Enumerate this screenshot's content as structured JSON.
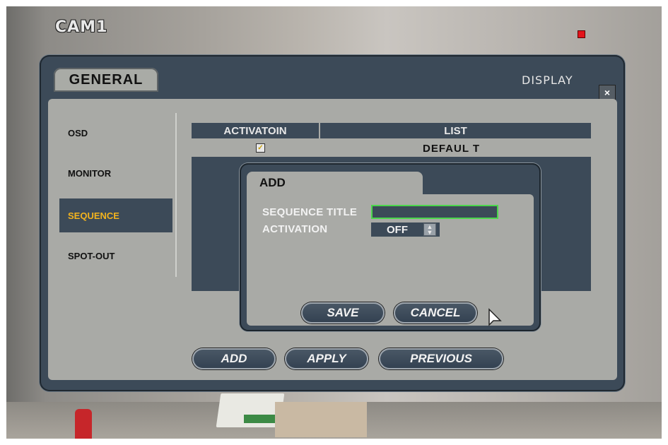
{
  "camera": {
    "label": "CAM1",
    "rec_color": "#e3141c"
  },
  "window": {
    "tab": "GENERAL",
    "title": "DISPLAY",
    "close": "×"
  },
  "sidebar": {
    "items": [
      {
        "label": "OSD",
        "selected": false
      },
      {
        "label": "MONITOR",
        "selected": false
      },
      {
        "label": "SEQUENCE",
        "selected": true
      },
      {
        "label": "SPOT-OUT",
        "selected": false
      }
    ]
  },
  "table": {
    "columns": [
      "ACTIVATOIN",
      "LIST"
    ],
    "rows": [
      {
        "activation_checked": true,
        "list": "DEFAUL T"
      }
    ]
  },
  "buttons": {
    "add": "ADD",
    "apply": "APPLY",
    "previous": "PREVIOUS"
  },
  "dialog": {
    "title": "ADD",
    "fields": {
      "sequence_title_label": "SEQUENCE TITLE",
      "sequence_title_value": "",
      "activation_label": "ACTIVATION",
      "activation_value": "OFF"
    },
    "buttons": {
      "save": "SAVE",
      "cancel": "CANCEL"
    }
  },
  "colors": {
    "accent": "#f2b31e",
    "panel": "#3c4a58",
    "content": "#a9aaa6",
    "focus": "#4cd64c"
  }
}
